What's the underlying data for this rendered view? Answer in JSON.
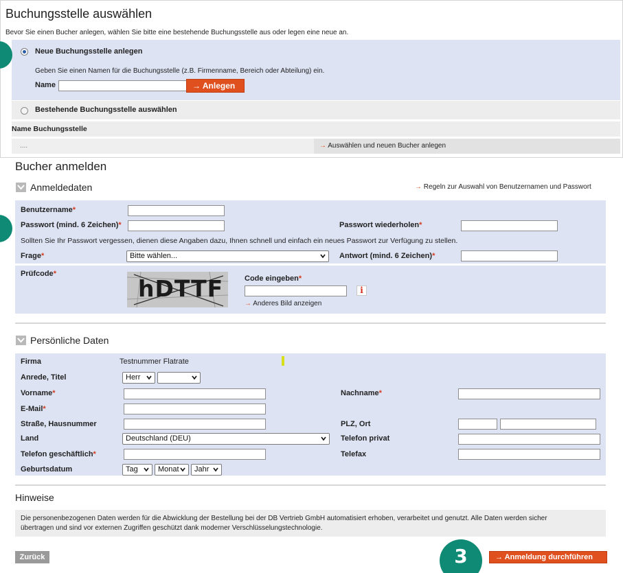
{
  "step1": {
    "title": "Buchungsstelle auswählen",
    "intro": "Bevor Sie einen Bucher anlegen, wählen Sie bitte eine bestehende Buchungsstelle aus oder legen eine neue an.",
    "option_new": "Neue Buchungsstelle anlegen",
    "new_hint": "Geben Sie einen Namen für die Buchungsstelle (z.B. Firmenname, Bereich oder Abteilung) ein.",
    "name_label": "Name",
    "name_value": "",
    "create_button": "Anlegen",
    "option_existing": "Bestehende Buchungsstelle auswählen",
    "column_header": "Name Buchungsstelle",
    "row_placeholder": "....",
    "select_link": "Auswählen und neuen Bucher anlegen"
  },
  "step2": {
    "title": "Bucher anmelden",
    "login_section": "Anmeldedaten",
    "rules_link": "Regeln zur Auswahl von Benutzernamen und Passwort",
    "username_label": "Benutzername",
    "password_label": "Passwort (mind. 6 Zeichen)",
    "password_repeat_label": "Passwort wiederholen",
    "recovery_hint": "Sollten Sie Ihr Passwort vergessen, dienen diese Angaben dazu, Ihnen schnell und einfach ein neues Passwort zur Verfügung zu stellen.",
    "question_label": "Frage",
    "question_value": "Bitte wählen...",
    "answer_label": "Antwort (mind. 6 Zeichen)",
    "captcha_label": "Prüfcode",
    "captcha_text": "hDTTF",
    "code_label": "Code eingeben",
    "info_icon": "i",
    "other_image_link": "Anderes Bild anzeigen",
    "required_mark": "*"
  },
  "personal": {
    "section": "Persönliche Daten",
    "firma_label": "Firma",
    "firma_value": "Testnummer Flatrate",
    "anrede_label": "Anrede, Titel",
    "anrede_value": "Herr",
    "titel_value": "",
    "vorname_label": "Vorname",
    "nachname_label": "Nachname",
    "email_label": "E-Mail",
    "strasse_label": "Straße, Hausnummer",
    "plz_label": "PLZ, Ort",
    "land_label": "Land",
    "land_value": "Deutschland (DEU)",
    "tel_privat_label": "Telefon privat",
    "tel_geschaeft_label": "Telefon geschäftlich",
    "telefax_label": "Telefax",
    "geburtsdatum_label": "Geburtsdatum",
    "tag_value": "Tag",
    "monat_value": "Monat",
    "jahr_value": "Jahr"
  },
  "hinweise": {
    "title": "Hinweise",
    "text_line1": "Die personenbezogenen Daten werden für die Abwicklung der Bestellung bei der DB Vertrieb GmbH automatisiert erhoben, verarbeitet und genutzt. Alle Daten werden sicher",
    "text_line2": "übertragen und sind vor externen Zugriffen geschützt dank moderner Verschlüsselungstechnologie."
  },
  "footer": {
    "back_button": "Zurück",
    "submit_button": "Anmeldung durchführen",
    "step_badge": "3"
  },
  "colors": {
    "accent": "#e0501e",
    "form_background": "#dde3f3",
    "step_badge": "#0f8a74"
  }
}
